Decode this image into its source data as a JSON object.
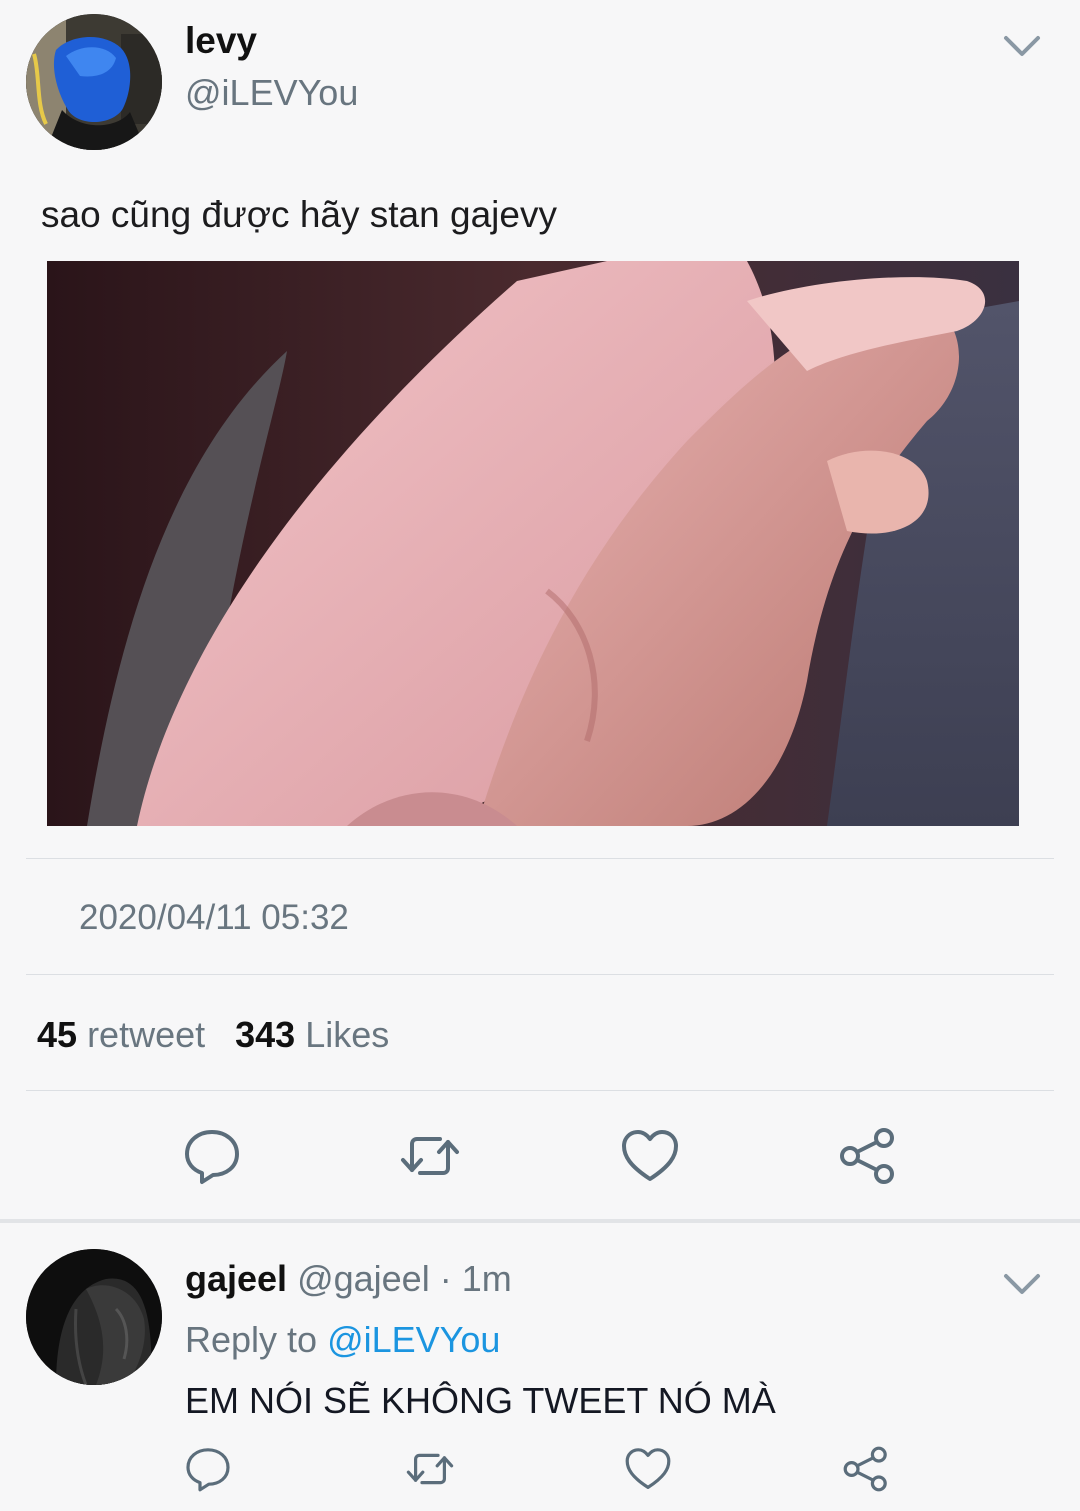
{
  "tweet": {
    "author_name": "levy",
    "author_handle": "@iLEVYou",
    "text": "sao cũng được hãy stan gajevy",
    "timestamp": "2020/04/11 05:32",
    "retweet_count": "45",
    "retweet_label": "retweet",
    "likes_count": "343",
    "likes_label": "Likes",
    "icons": [
      "chevron-down-icon",
      "reply-icon",
      "retweet-icon",
      "like-icon",
      "share-icon"
    ]
  },
  "reply": {
    "author_name": "gajeel",
    "author_handle": "@gajeel",
    "time_sep": " · ",
    "time": "1m",
    "reply_to_label": "Reply to ",
    "reply_to_handle": "@iLEVYou",
    "text": "EM NÓI SẼ KHÔNG TWEET NÓ MÀ"
  },
  "colors": {
    "background": "#f7f7f8",
    "secondary_text": "#68757f",
    "link": "#1b95e0",
    "icon": "#5b6d7b",
    "divider": "#dcdfe3"
  }
}
